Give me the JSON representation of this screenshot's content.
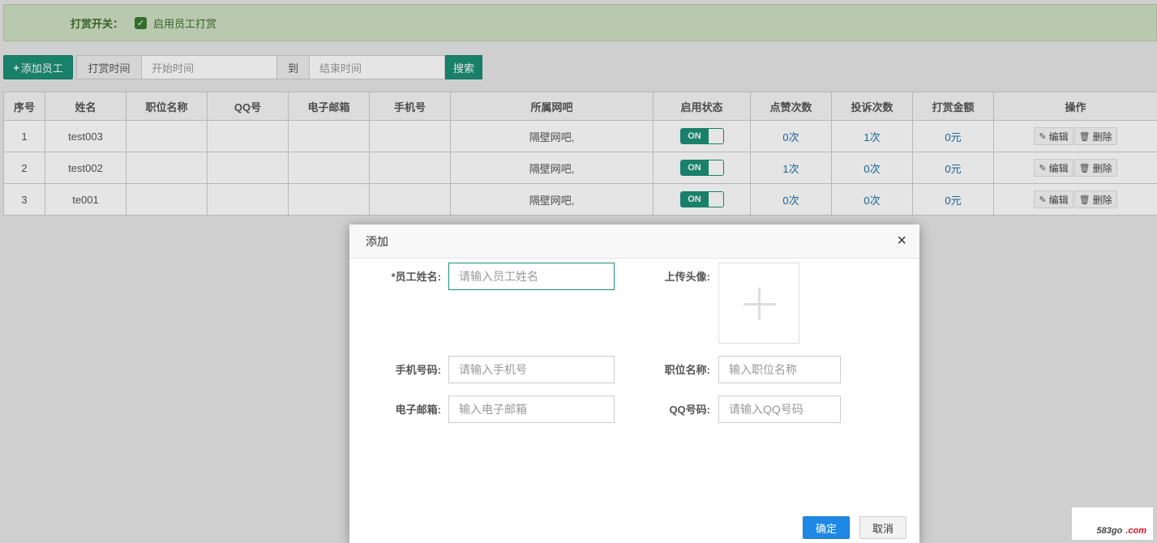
{
  "topbar": {
    "label": "打赏开关：",
    "checkbox_label": "启用员工打赏",
    "checked": true
  },
  "toolbar": {
    "add_button": "添加员工",
    "time_label": "打赏时间",
    "start_placeholder": "开始时间",
    "to_label": "到",
    "end_placeholder": "结束时间",
    "search_button": "搜索"
  },
  "table": {
    "headers": [
      "序号",
      "姓名",
      "职位名称",
      "QQ号",
      "电子邮箱",
      "手机号",
      "所属网吧",
      "启用状态",
      "点赞次数",
      "投诉次数",
      "打赏金额",
      "操作"
    ],
    "rows": [
      {
        "no": "1",
        "name": "test003",
        "position": "",
        "qq": "",
        "email": "",
        "phone": "",
        "cafe": "隔壁网吧,",
        "status": "ON",
        "likes": "0次",
        "complaints": "1次",
        "reward": "0元"
      },
      {
        "no": "2",
        "name": "test002",
        "position": "",
        "qq": "",
        "email": "",
        "phone": "",
        "cafe": "隔壁网吧,",
        "status": "ON",
        "likes": "1次",
        "complaints": "0次",
        "reward": "0元"
      },
      {
        "no": "3",
        "name": "te001",
        "position": "",
        "qq": "",
        "email": "",
        "phone": "",
        "cafe": "隔壁网吧,",
        "status": "ON",
        "likes": "0次",
        "complaints": "0次",
        "reward": "0元"
      }
    ],
    "edit_label": "编辑",
    "delete_label": "删除"
  },
  "modal": {
    "title": "添加",
    "close": "×",
    "name_label": "*员工姓名:",
    "name_placeholder": "请输入员工姓名",
    "avatar_label": "上传头像:",
    "phone_label": "手机号码:",
    "phone_placeholder": "请输入手机号",
    "position_label": "职位名称:",
    "position_placeholder": "输入职位名称",
    "email_label": "电子邮箱:",
    "email_placeholder": "输入电子邮箱",
    "qq_label": "QQ号码:",
    "qq_placeholder": "请输入QQ号码",
    "ok": "确定",
    "cancel": "取消"
  },
  "watermark": {
    "prefix": "583go",
    "suffix": ".com"
  },
  "colors": {
    "primary": "#1c8f77",
    "confirm": "#1e88e5",
    "link": "#1a6ea8",
    "notice_bg": "#cfe0c3"
  }
}
